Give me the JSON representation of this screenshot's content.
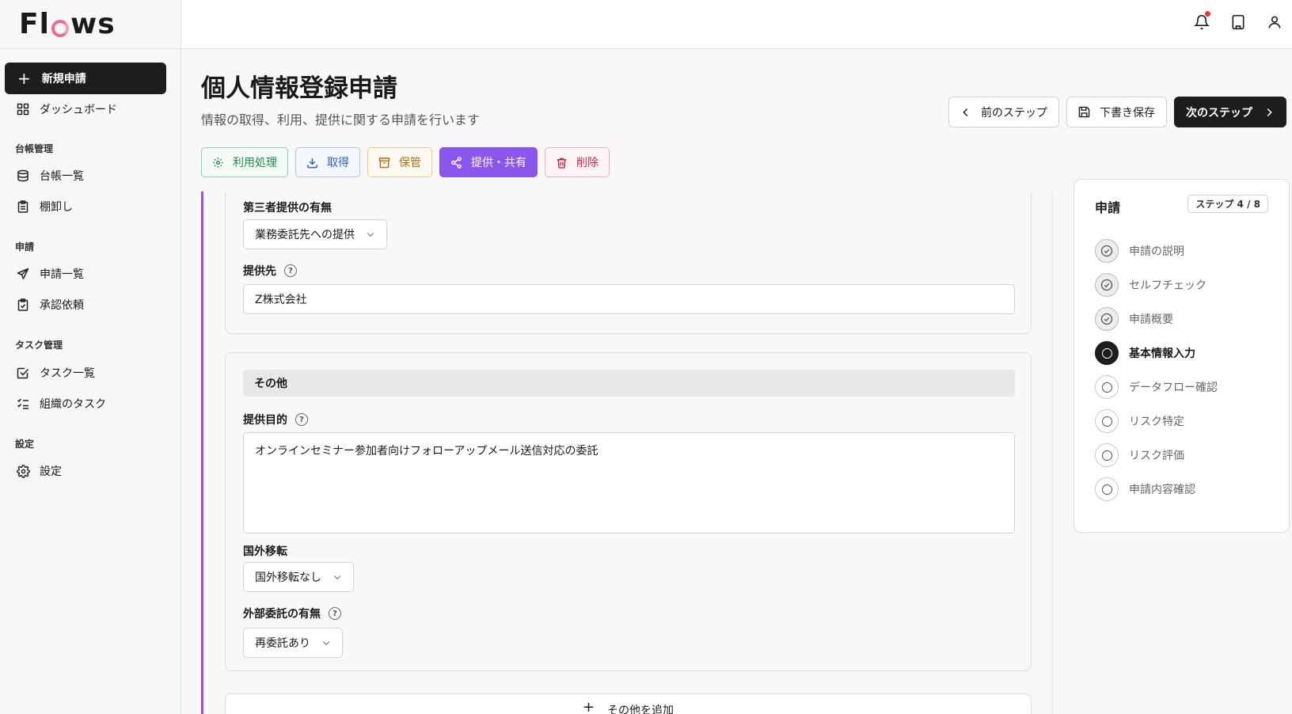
{
  "app": {
    "logo_pre": "Fl",
    "logo_post": "ws"
  },
  "sidebar": {
    "new_button": "新規申請",
    "dashboard": "ダッシュボード",
    "sections": [
      {
        "title": "台帳管理",
        "items": [
          "台帳一覧",
          "棚卸し"
        ]
      },
      {
        "title": "申請",
        "items": [
          "申請一覧",
          "承認依頼"
        ]
      },
      {
        "title": "タスク管理",
        "items": [
          "タスク一覧",
          "組織のタスク"
        ]
      },
      {
        "title": "設定",
        "items": [
          "設定"
        ]
      }
    ]
  },
  "header": {
    "title": "個人情報登録申請",
    "subtitle": "情報の取得、利用、提供に関する申請を行います",
    "prev_step": "前のステップ",
    "save_draft": "下書き保存",
    "next_step": "次のステップ"
  },
  "tabs": [
    "利用処理",
    "取得",
    "保管",
    "提供・共有",
    "削除"
  ],
  "form": {
    "third_party_label": "第三者提供の有無",
    "third_party_value": "業務委託先への提供",
    "recipient_label": "提供先",
    "recipient_value": "Z株式会社",
    "other_section": "その他",
    "purpose_label": "提供目的",
    "purpose_value": "オンラインセミナー参加者向けフォローアップメール送信対応の委託",
    "transfer_label": "国外移転",
    "transfer_value": "国外移転なし",
    "outsourcing_label": "外部委託の有無",
    "outsourcing_value": "再委託あり",
    "add_other": "その他を追加"
  },
  "steps_panel": {
    "title": "申請",
    "badge": "ステップ 4 / 8",
    "steps": [
      "申請の説明",
      "セルフチェック",
      "申請概要",
      "基本情報入力",
      "データフロー確認",
      "リスク特定",
      "リスク評価",
      "申請内容確認"
    ],
    "current_index": 3
  },
  "colors": {
    "accent": "#8b56ec",
    "dark": "#1d1d1d"
  }
}
